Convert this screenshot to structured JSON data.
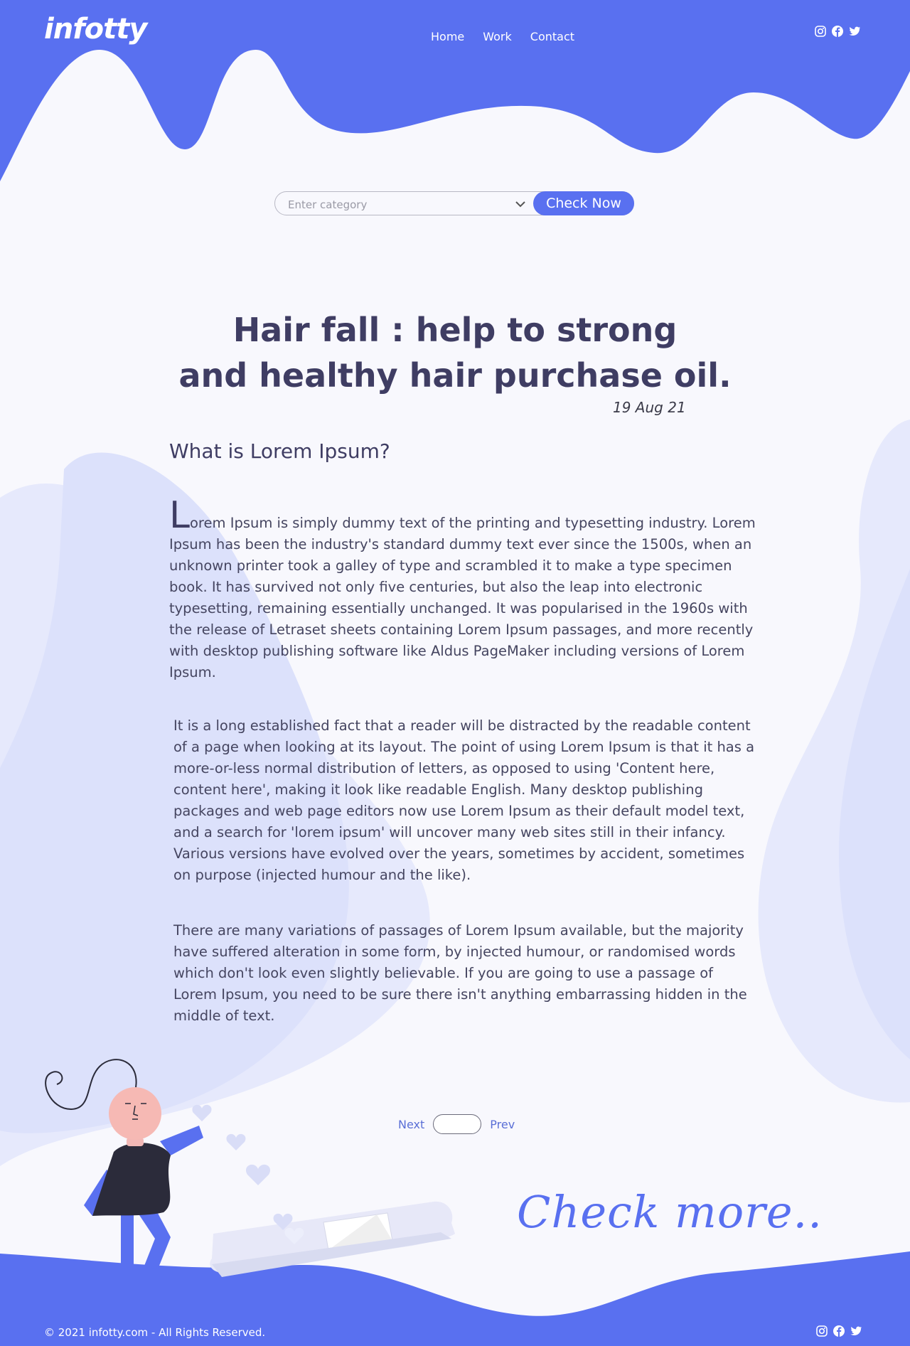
{
  "header": {
    "logo": "infotty",
    "nav": [
      "Home",
      "Work",
      "Contact"
    ],
    "social_icons": [
      "instagram-icon",
      "facebook-icon",
      "twitter-icon"
    ]
  },
  "search": {
    "placeholder": "Enter category",
    "button_label": "Check Now"
  },
  "article": {
    "title_line1": "Hair fall : help to strong",
    "title_line2": "and healthy hair purchase oil.",
    "date": "19 Aug 21",
    "heading": "What is Lorem Ipsum?",
    "drop_cap": "L",
    "para1_rest": "orem Ipsum is simply dummy text of the printing and typesetting industry. Lorem Ipsum has been the industry's standard dummy text ever since the 1500s, when an unknown printer took a galley of type and scrambled it to make a type specimen book. It has survived not only five centuries, but also the leap into electronic typesetting, remaining essentially unchanged. It was popularised in the 1960s with the release of Letraset sheets containing Lorem Ipsum passages, and more recently with desktop publishing software like Aldus PageMaker including versions of Lorem Ipsum.",
    "para2": "It is a long established fact that a reader will be distracted by the readable content of a page when looking at its layout. The point of using Lorem Ipsum is that it has a more-or-less normal distribution of letters, as opposed to using 'Content here, content here', making it look like readable English. Many desktop publishing packages and web page editors now use Lorem Ipsum as their default model text, and a search for 'lorem ipsum' will uncover many web sites still in their infancy. Various versions have evolved over the years, sometimes by accident, sometimes on purpose (injected humour and the like).",
    "para3": "There are many variations of passages of Lorem Ipsum available, but the majority have suffered alteration in some form, by injected humour, or randomised words which don't look even slightly believable. If you are going to use a passage of Lorem Ipsum, you need to be sure there isn't anything embarrassing hidden in the middle of text."
  },
  "pager": {
    "next": "Next",
    "prev": "Prev"
  },
  "cta": "Check more..",
  "footer": {
    "copyright": "© 2021 infotty.com - All Rights Reserved."
  },
  "colors": {
    "primary": "#5970f0",
    "text": "#3f3d63",
    "blob": "#dde2fb",
    "page_bg": "#f8f8fd"
  }
}
